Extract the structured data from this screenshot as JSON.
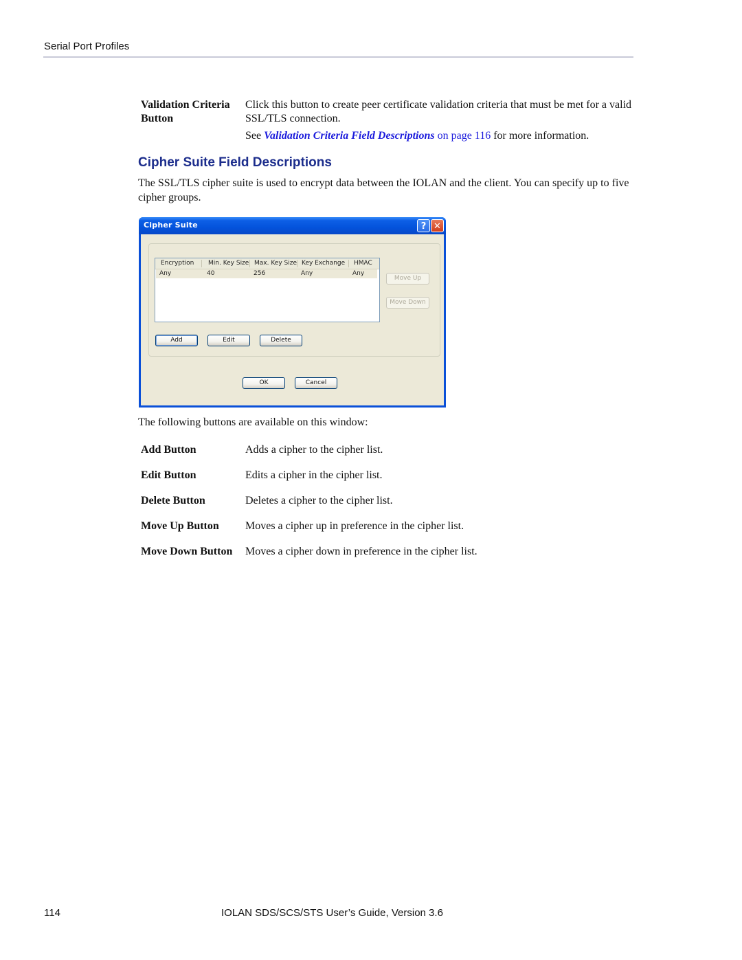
{
  "header": {
    "running_title": "Serial Port Profiles"
  },
  "validation_criteria": {
    "term_line1": "Validation Criteria",
    "term_line2": "Button",
    "desc": "Click this button to create peer certificate validation criteria that must be met for a valid SSL/TLS connection.",
    "see_prefix": "See ",
    "see_link": "Validation Criteria Field Descriptions",
    "see_page_link": " on page 116",
    "see_suffix": " for more information."
  },
  "section": {
    "title": "Cipher Suite Field Descriptions",
    "intro": "The SSL/TLS cipher suite is used to encrypt data between the IOLAN and the client. You can specify up to five cipher groups."
  },
  "dialog": {
    "title": "Cipher Suite",
    "help_glyph": "?",
    "close_glyph": "✕",
    "list": {
      "columns": [
        "Encryption",
        "Min. Key Size",
        "Max. Key Size",
        "Key Exchange",
        "HMAC"
      ],
      "rows": [
        [
          "Any",
          "40",
          "256",
          "Any",
          "Any"
        ]
      ]
    },
    "buttons": {
      "move_up": "Move Up",
      "move_down": "Move Down",
      "add": "Add",
      "edit": "Edit",
      "delete": "Delete",
      "ok": "OK",
      "cancel": "Cancel"
    },
    "colors": {
      "titlebar": "#0453dc",
      "client": "#ece9d8",
      "close": "#cf3e1c"
    }
  },
  "buttons_intro": "The following buttons are available on this window:",
  "button_defs": [
    {
      "term": "Add Button",
      "desc": "Adds a cipher to the cipher list."
    },
    {
      "term": "Edit Button",
      "desc": "Edits a cipher in the cipher list."
    },
    {
      "term": "Delete Button",
      "desc": "Deletes a cipher to the cipher list."
    },
    {
      "term": "Move Up Button",
      "desc": "Moves a cipher up in preference in the cipher list."
    },
    {
      "term": "Move Down Button",
      "desc": "Moves a cipher down in preference in the cipher list."
    }
  ],
  "footer": {
    "page_number": "114",
    "doc_title": "IOLAN SDS/SCS/STS User’s Guide, Version 3.6"
  }
}
